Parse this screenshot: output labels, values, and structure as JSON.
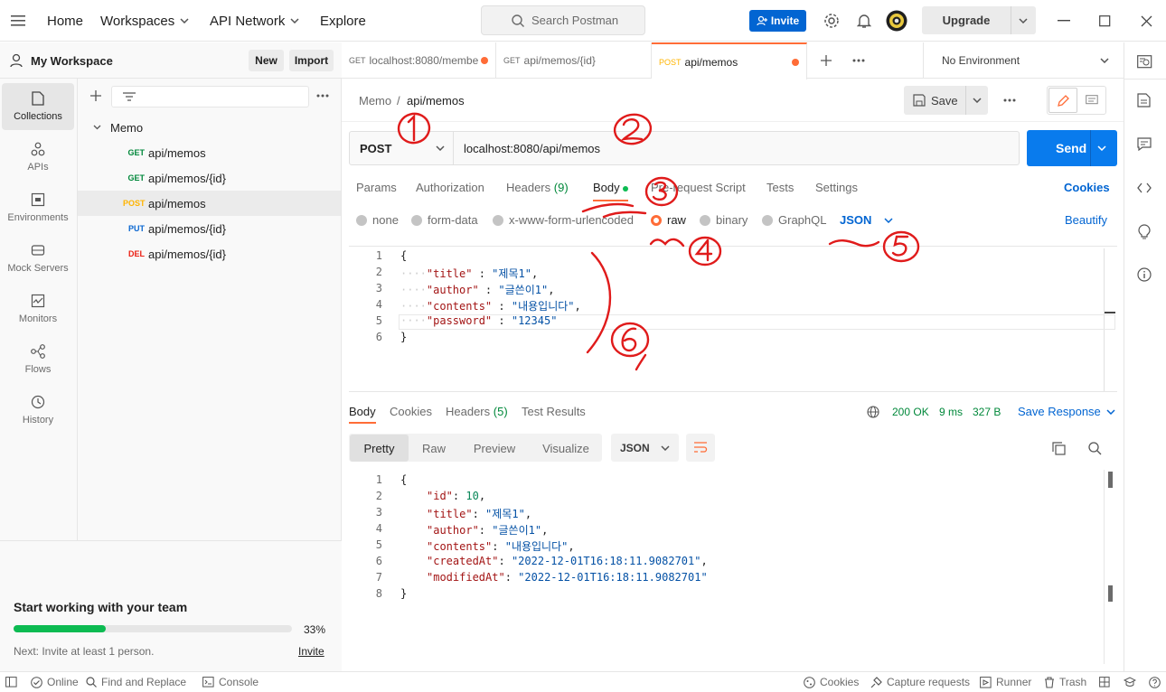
{
  "topbar": {
    "home": "Home",
    "workspaces": "Workspaces",
    "api_network": "API Network",
    "explore": "Explore",
    "search_placeholder": "Search Postman",
    "invite": "Invite",
    "upgrade": "Upgrade"
  },
  "workspace": {
    "name": "My Workspace",
    "new": "New",
    "import": "Import"
  },
  "rail": [
    {
      "label": "Collections",
      "icon": "collections-icon"
    },
    {
      "label": "APIs",
      "icon": "apis-icon"
    },
    {
      "label": "Environments",
      "icon": "environments-icon"
    },
    {
      "label": "Mock Servers",
      "icon": "mock-servers-icon"
    },
    {
      "label": "Monitors",
      "icon": "monitors-icon"
    },
    {
      "label": "Flows",
      "icon": "flows-icon"
    },
    {
      "label": "History",
      "icon": "history-icon"
    }
  ],
  "collection": {
    "name": "Memo",
    "requests": [
      {
        "method": "GET",
        "path": "api/memos"
      },
      {
        "method": "GET",
        "path": "api/memos/{id}"
      },
      {
        "method": "POST",
        "path": "api/memos"
      },
      {
        "method": "PUT",
        "path": "api/memos/{id}"
      },
      {
        "method": "DEL",
        "path": "api/memos/{id}"
      }
    ]
  },
  "team": {
    "title": "Start working with your team",
    "progress_percent": 33,
    "progress_label": "33%",
    "next": "Next: Invite at least 1 person.",
    "invite": "Invite"
  },
  "tabs": [
    {
      "method": "GET",
      "label": "localhost:8080/membe",
      "unsaved": true
    },
    {
      "method": "GET",
      "label": "api/memos/{id}",
      "unsaved": false
    },
    {
      "method": "POST",
      "label": "api/memos",
      "unsaved": true,
      "active": true
    }
  ],
  "environment": "No Environment",
  "breadcrumb": {
    "parent": "Memo",
    "sep": "/",
    "current": "api/memos"
  },
  "save": "Save",
  "request": {
    "method": "POST",
    "url": "localhost:8080/api/memos",
    "send": "Send"
  },
  "request_tabs": {
    "params": "Params",
    "authorization": "Authorization",
    "headers": "Headers",
    "headers_count": "(9)",
    "body": "Body",
    "pre_request": "Pre-request Script",
    "tests": "Tests",
    "settings": "Settings",
    "cookies": "Cookies"
  },
  "body_types": {
    "none": "none",
    "form_data": "form-data",
    "urlencoded": "x-www-form-urlencoded",
    "raw": "raw",
    "binary": "binary",
    "graphql": "GraphQL",
    "format": "JSON",
    "beautify": "Beautify"
  },
  "request_body": {
    "title": "제목1",
    "author": "글쓴이1",
    "contents": "내용입니다",
    "password": "12345"
  },
  "response_tabs": {
    "body": "Body",
    "cookies": "Cookies",
    "headers": "Headers",
    "headers_count": "(5)",
    "test_results": "Test Results"
  },
  "response_meta": {
    "status": "200 OK",
    "time": "9 ms",
    "size": "327 B",
    "save_response": "Save Response"
  },
  "view_modes": {
    "pretty": "Pretty",
    "raw": "Raw",
    "preview": "Preview",
    "visualize": "Visualize",
    "format": "JSON"
  },
  "response_body": {
    "id": 10,
    "title": "제목1",
    "author": "글쓴이1",
    "contents": "내용입니다",
    "createdAt": "2022-12-01T16:18:11.9082701",
    "modifiedAt": "2022-12-01T16:18:11.9082701"
  },
  "annotations": [
    "1",
    "2",
    "3",
    "4",
    "5",
    "6"
  ],
  "statusbar": {
    "online": "Online",
    "find_replace": "Find and Replace",
    "console": "Console",
    "cookies": "Cookies",
    "capture": "Capture requests",
    "runner": "Runner",
    "trash": "Trash"
  },
  "colors": {
    "accent": "#ff6c37",
    "primary": "#0265d2",
    "send": "#097bed",
    "annotation": "#e01b1b",
    "progress": "#0cbb52"
  }
}
